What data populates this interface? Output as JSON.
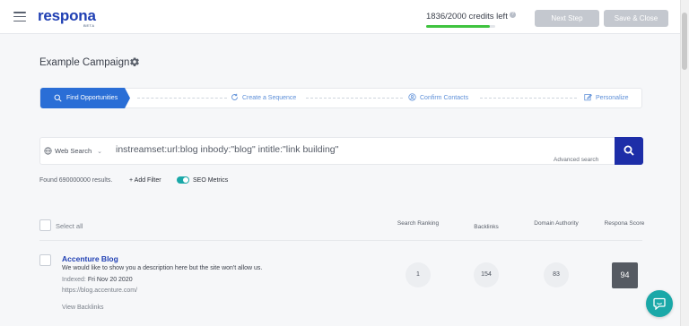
{
  "header": {
    "logo": "respona",
    "logo_badge": "BETA",
    "credits_text": "1836/2000 credits left",
    "credits_info": "?",
    "credits_progress": 0.918,
    "next_step_label": "Next Step",
    "save_close_label": "Save & Close"
  },
  "campaign": {
    "title": "Example Campaign"
  },
  "steps": [
    {
      "label": "Find Opportunities",
      "icon": "search-icon",
      "active": true
    },
    {
      "label": "Create a Sequence",
      "icon": "refresh-icon",
      "active": false
    },
    {
      "label": "Confirm Contacts",
      "icon": "user-circle-icon",
      "active": false
    },
    {
      "label": "Personalize",
      "icon": "edit-icon",
      "active": false
    }
  ],
  "search": {
    "engine": "Web Search",
    "query": "instreamset:url:blog inbody:\"blog\" intitle:\"link building\"",
    "advanced_label": "Advanced search"
  },
  "filters": {
    "found_text": "Found 690000000 results.",
    "add_filter_label": "+ Add Filter",
    "seo_metrics_label": "SEO Metrics",
    "seo_metrics_on": true
  },
  "table": {
    "select_all_label": "Select all",
    "columns": [
      "Search Ranking",
      "Backlinks",
      "Domain Authority",
      "Respona Score"
    ],
    "rows": [
      {
        "title": "Accenture Blog",
        "description": "We would like to show you a description here but the site won't allow us.",
        "indexed_label": "Indexed:",
        "indexed_date": "Fri Nov 20 2020",
        "url": "https://blog.accenture.com/",
        "view_backlinks": "View Backlinks",
        "search_ranking": "1",
        "backlinks": "154",
        "domain_authority": "83",
        "respona_score": "94"
      }
    ]
  },
  "colors": {
    "brand": "#1f3fb3",
    "active_step": "#2a6ed6",
    "search_button": "#1d2ea8",
    "toggle_on": "#1aa8a8",
    "progress": "#3fc33f"
  }
}
